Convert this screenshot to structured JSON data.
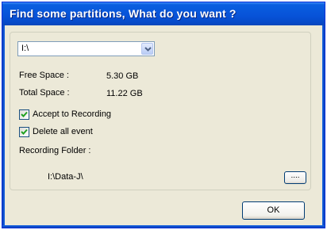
{
  "dialog": {
    "title": "Find some partitions, What do you want ?",
    "drive_select": {
      "value": "I:\\"
    },
    "free_space": {
      "label": "Free Space :",
      "value": "5.30 GB"
    },
    "total_space": {
      "label": "Total Space :",
      "value": "11.22 GB"
    },
    "accept_recording": {
      "label": "Accept to Recording",
      "checked": true
    },
    "delete_all_event": {
      "label": "Delete all event",
      "checked": true
    },
    "recording_folder": {
      "label": "Recording Folder :",
      "path": "I:\\Data-J\\"
    },
    "browse_label": "....",
    "ok_label": "OK"
  },
  "colors": {
    "title_bar": "#0752d8",
    "dialog_bg": "#ece9d8",
    "check_mark": "#21a121"
  }
}
